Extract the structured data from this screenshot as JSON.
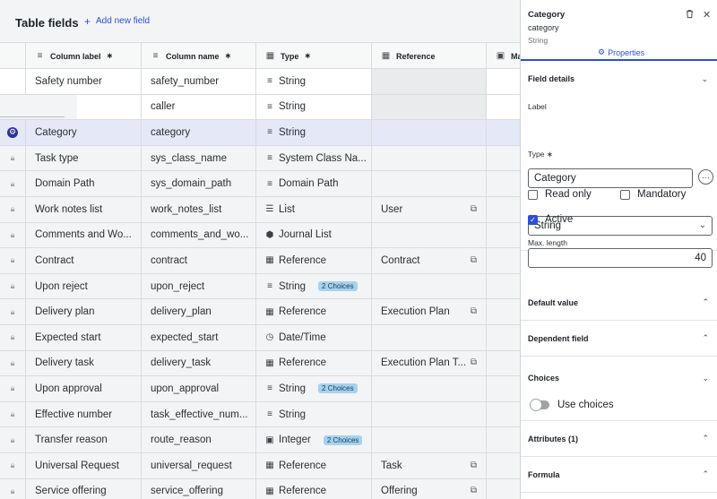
{
  "header": {
    "title": "Table fields",
    "add_label": "Add new field"
  },
  "columns": [
    {
      "label": "Column label",
      "required": "∗",
      "icon": "lines-icon"
    },
    {
      "label": "Column name",
      "required": "∗",
      "icon": "lines-icon"
    },
    {
      "label": "Type",
      "required": "∗",
      "icon": "table-icon"
    },
    {
      "label": "Reference",
      "required": "",
      "icon": "table-icon"
    },
    {
      "label": "Ma",
      "required": "",
      "icon": "table-icon"
    }
  ],
  "rows": [
    {
      "label": "Safety number",
      "name": "safety_number",
      "type": "String",
      "type_icon": "≡",
      "badge": "",
      "reference": "",
      "ext": false,
      "white": true
    },
    {
      "label": "",
      "name": "caller",
      "type": "String",
      "type_icon": "≡",
      "badge": "",
      "reference": "",
      "ext": false,
      "white": true
    },
    {
      "label": "Category",
      "name": "category",
      "type": "String",
      "type_icon": "≡",
      "badge": "",
      "reference": "",
      "ext": false,
      "selected": true
    },
    {
      "label": "Task type",
      "name": "sys_class_name",
      "type": "System Class Na...",
      "type_icon": "≡",
      "badge": "",
      "reference": "",
      "ext": false
    },
    {
      "label": "Domain Path",
      "name": "sys_domain_path",
      "type": "Domain Path",
      "type_icon": "≡",
      "badge": "",
      "reference": "",
      "ext": false
    },
    {
      "label": "Work notes list",
      "name": "work_notes_list",
      "type": "List",
      "type_icon": "☰",
      "badge": "",
      "reference": "User",
      "ext": true
    },
    {
      "label": "Comments and Wo...",
      "name": "comments_and_wo...",
      "type": "Journal List",
      "type_icon": "⬢",
      "badge": "",
      "reference": "",
      "ext": false
    },
    {
      "label": "Contract",
      "name": "contract",
      "type": "Reference",
      "type_icon": "▦",
      "badge": "",
      "reference": "Contract",
      "ext": true
    },
    {
      "label": "Upon reject",
      "name": "upon_reject",
      "type": "String",
      "type_icon": "≡",
      "badge": "2 Choices",
      "reference": "",
      "ext": false
    },
    {
      "label": "Delivery plan",
      "name": "delivery_plan",
      "type": "Reference",
      "type_icon": "▦",
      "badge": "",
      "reference": "Execution Plan",
      "ext": true
    },
    {
      "label": "Expected start",
      "name": "expected_start",
      "type": "Date/Time",
      "type_icon": "◷",
      "badge": "",
      "reference": "",
      "ext": false
    },
    {
      "label": "Delivery task",
      "name": "delivery_task",
      "type": "Reference",
      "type_icon": "▦",
      "badge": "",
      "reference": "Execution Plan T...",
      "ext": true
    },
    {
      "label": "Upon approval",
      "name": "upon_approval",
      "type": "String",
      "type_icon": "≡",
      "badge": "2 Choices",
      "reference": "",
      "ext": false
    },
    {
      "label": "Effective number",
      "name": "task_effective_num...",
      "type": "String",
      "type_icon": "≡",
      "badge": "",
      "reference": "",
      "ext": false
    },
    {
      "label": "Transfer reason",
      "name": "route_reason",
      "type": "Integer",
      "type_icon": "▣",
      "badge": "2 Choices",
      "reference": "",
      "ext": false
    },
    {
      "label": "Universal Request",
      "name": "universal_request",
      "type": "Reference",
      "type_icon": "▦",
      "badge": "",
      "reference": "Task",
      "ext": true
    },
    {
      "label": "Service offering",
      "name": "service_offering",
      "type": "Reference",
      "type_icon": "▦",
      "badge": "",
      "reference": "Offering",
      "ext": true
    }
  ],
  "panel": {
    "title": "Category",
    "subtitle": "category",
    "type": "String",
    "tab": "Properties",
    "field_details": "Field details",
    "label_label": "Label",
    "label_value": "Category",
    "type_label": "Type ∗",
    "type_value": "String",
    "read_only": "Read only",
    "mandatory": "Mandatory",
    "active": "Active",
    "max_length_label": "Max. length",
    "max_length_value": "40",
    "default_value": "Default value",
    "dependent_field": "Dependent field",
    "choices": "Choices",
    "use_choices": "Use choices",
    "attributes": "Attributes (1)",
    "formula": "Formula"
  },
  "colors": {
    "accent": "#2b4fd6",
    "selected_row": "#e5e8f7",
    "badge": "#a6d2ef"
  }
}
